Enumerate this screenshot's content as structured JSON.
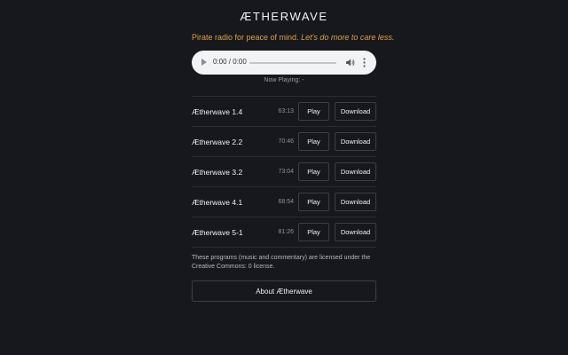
{
  "header": {
    "brand": "ÆTHERWAVE",
    "tagline_plain": "Pirate radio for peace of mind.",
    "tagline_italic": "Let's do more to care less."
  },
  "player": {
    "time": "0:00 / 0:00",
    "progress": 0
  },
  "now_playing": "Now Playing: -",
  "programs": [
    {
      "name": "Ætherwave 1.4",
      "duration": "63:13",
      "play_label": "Play",
      "download_label": "Download"
    },
    {
      "name": "Ætherwave 2.2",
      "duration": "70:46",
      "play_label": "Play",
      "download_label": "Download"
    },
    {
      "name": "Ætherwave 3.2",
      "duration": "73:04",
      "play_label": "Play",
      "download_label": "Download"
    },
    {
      "name": "Ætherwave 4.1",
      "duration": "68:54",
      "play_label": "Play",
      "download_label": "Download"
    },
    {
      "name": "Ætherwave 5-1",
      "duration": "81:26",
      "play_label": "Play",
      "download_label": "Download"
    }
  ],
  "license_text": "These programs (music and commentary) are licensed under the Creative Commons: 0 license.",
  "about_button": "About Ætherwave",
  "colors": {
    "background": "#16181d",
    "accent": "#e0a23a"
  }
}
